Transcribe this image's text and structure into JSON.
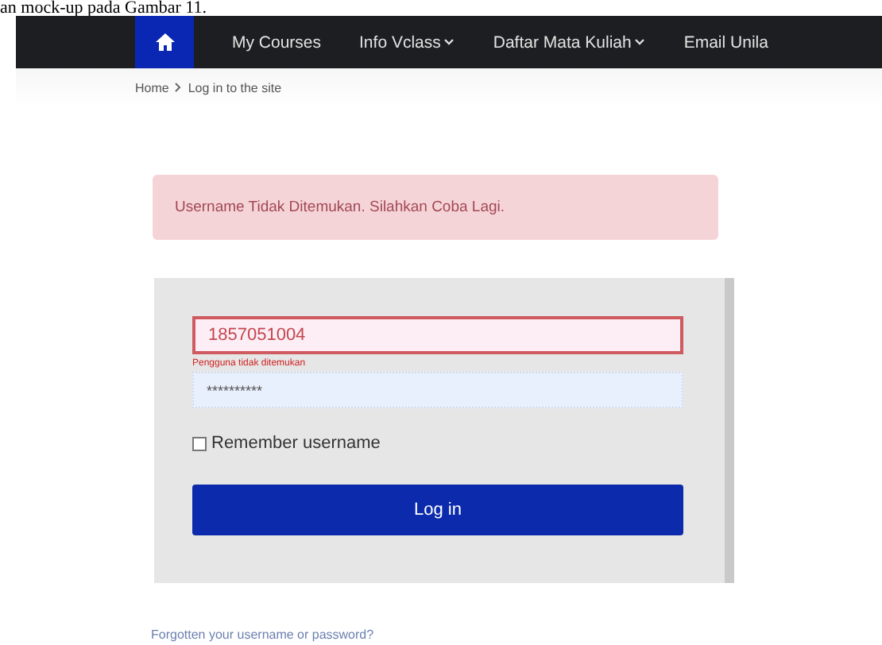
{
  "document_text": "an mock-up pada Gambar 11.",
  "navbar": {
    "items": [
      {
        "label": "My Courses",
        "dropdown": false
      },
      {
        "label": "Info Vclass",
        "dropdown": true
      },
      {
        "label": "Daftar Mata Kuliah",
        "dropdown": true
      },
      {
        "label": "Email Unila",
        "dropdown": false
      }
    ]
  },
  "breadcrumb": [
    "Home",
    "Log in to the site"
  ],
  "alert": "Username Tidak Ditemukan. Silahkan Coba Lagi.",
  "login": {
    "username": "1857051004",
    "username_error": "Pengguna tidak ditemukan",
    "password": "**********",
    "remember": {
      "label": "Remember username",
      "checked": false
    },
    "button": "Log in"
  },
  "forgot_link": "Forgotten your username or password?"
}
